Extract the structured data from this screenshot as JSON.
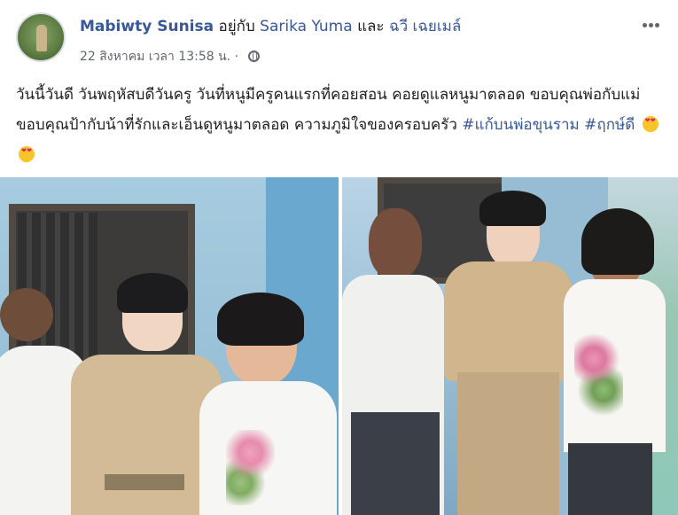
{
  "post": {
    "author": "Mabiwty Sunisa",
    "with_word": "อยู่กับ",
    "tagged_1": "Sarika Yuma",
    "and_word": "และ",
    "tagged_2": "ฉวี เฉยเมล์",
    "timestamp": "22 สิงหาคม เวลา 13:58 น. ·",
    "text_main": "วันนี้วันดี วันพฤหัสบดีวันครู วันที่หนูมีครูคนแรกที่คอยสอน คอยดูแลหนูมาตลอด ขอบคุณพ่อกับแม่ ขอบคุณป้ากับน้าที่รักและเอ็นดูหนูมาตลอด ความภูมิใจของครอบครัว",
    "hashtag_1": "#แก้บนพ่อขุนราม",
    "hashtag_2": "#ฤกษ์ดี"
  },
  "icons": {
    "privacy": "globe-icon",
    "options": "more-options-icon",
    "reaction": "heart-eyes-emoji"
  },
  "colors": {
    "link": "#385898",
    "meta": "#606770",
    "text": "#1c1e21"
  }
}
